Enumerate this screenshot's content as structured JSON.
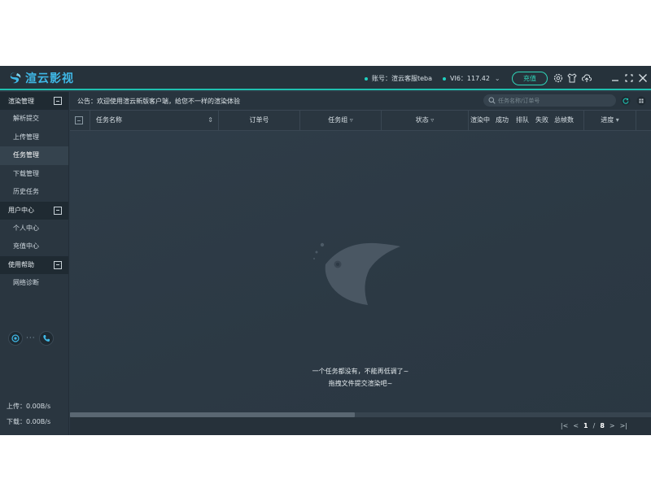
{
  "app": {
    "name": "渲云影视",
    "account": "账号：渲云客服teba",
    "vip": "VI6：117.42",
    "recharge_label": "充值"
  },
  "sidebar": {
    "groups": [
      {
        "title": "渲染管理",
        "items": [
          "解析提交",
          "上传管理",
          "任务管理",
          "下载管理",
          "历史任务"
        ]
      },
      {
        "title": "用户中心",
        "items": [
          "个人中心",
          "充值中心"
        ]
      },
      {
        "title": "使用帮助",
        "items": [
          "网络诊断"
        ]
      }
    ],
    "active_item": "任务管理",
    "upload_speed": "上传：0.00B/s",
    "download_speed": "下载：0.00B/s"
  },
  "notice": {
    "text": "公告：欢迎使用渲云新版客户端，给您不一样的渲染体验",
    "search_placeholder": "任务名称/订单号"
  },
  "table": {
    "columns": [
      "任务名称",
      "订单号",
      "任务组",
      "状态",
      "渲染中",
      "成功",
      "排队",
      "失败",
      "总帧数",
      "进度"
    ]
  },
  "empty_state": {
    "line1": "一个任务都没有，不能再低调了~",
    "line2": "拖拽文件提交渲染吧~"
  },
  "pagination": {
    "current": "1",
    "separator": "/",
    "total": "8"
  },
  "colors": {
    "accent": "#1fc0b0",
    "logo": "#3fb8e6",
    "background": "#2d3a45"
  }
}
